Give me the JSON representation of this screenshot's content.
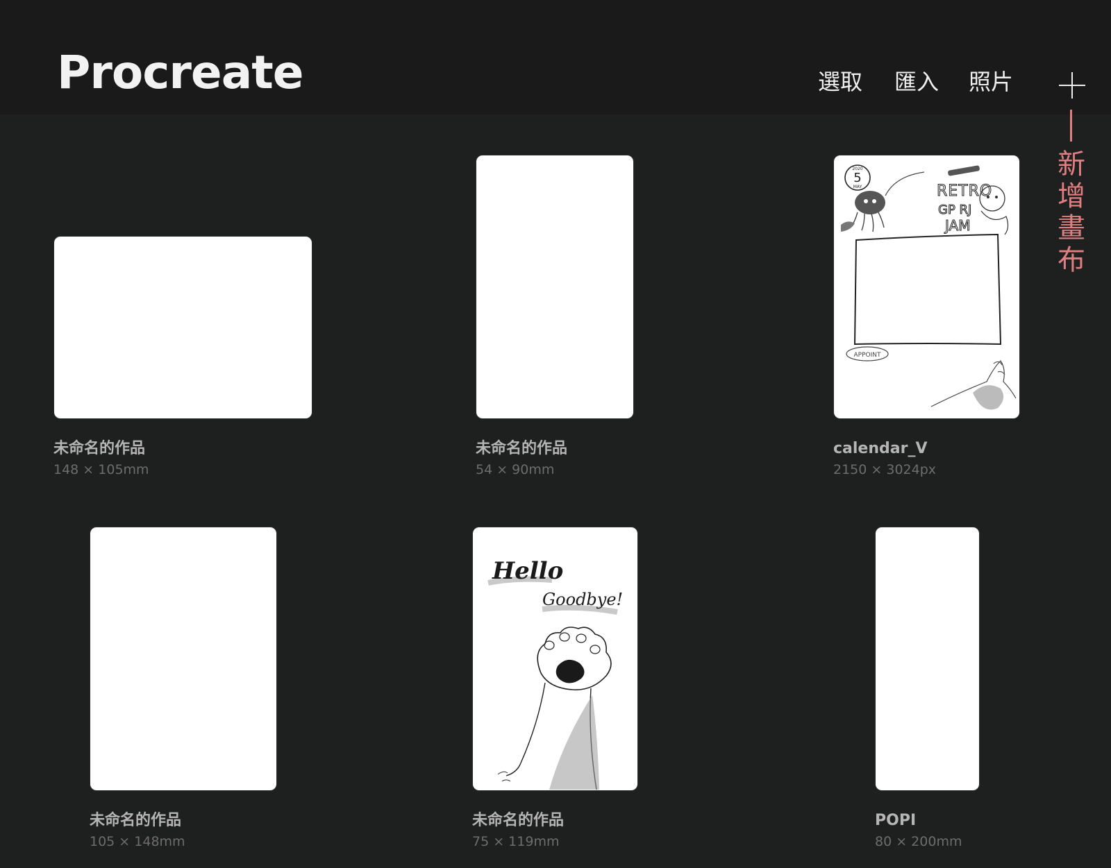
{
  "header": {
    "app_title": "Procreate",
    "select_label": "選取",
    "import_label": "匯入",
    "photos_label": "照片"
  },
  "annotation": {
    "new_canvas_label": "新增畫布",
    "color": "#e07f82"
  },
  "gallery": {
    "items": [
      {
        "title": "未命名的作品",
        "size": "148 × 105mm",
        "thumbnail": "blank"
      },
      {
        "title": "未命名的作品",
        "size": "54 × 90mm",
        "thumbnail": "blank"
      },
      {
        "title": "calendar_V",
        "size": "2150 × 3024px",
        "thumbnail": "calendar-sketch"
      },
      {
        "title": "未命名的作品",
        "size": "105 × 148mm",
        "thumbnail": "blank"
      },
      {
        "title": "未命名的作品",
        "size": "75 × 119mm",
        "thumbnail": "cat-paw-sketch"
      },
      {
        "title": "POPI",
        "size": "80 × 200mm",
        "thumbnail": "blank"
      }
    ]
  },
  "thumbnails": {
    "calendar": {
      "badge_year": "2020",
      "badge_day": "5",
      "badge_month": "MAY",
      "line1": "RETRO",
      "line2": "GP RJ",
      "line3": "JAM",
      "footer": "APPOINT"
    },
    "paw": {
      "line1": "Hello",
      "line2": "Goodbye!"
    }
  }
}
